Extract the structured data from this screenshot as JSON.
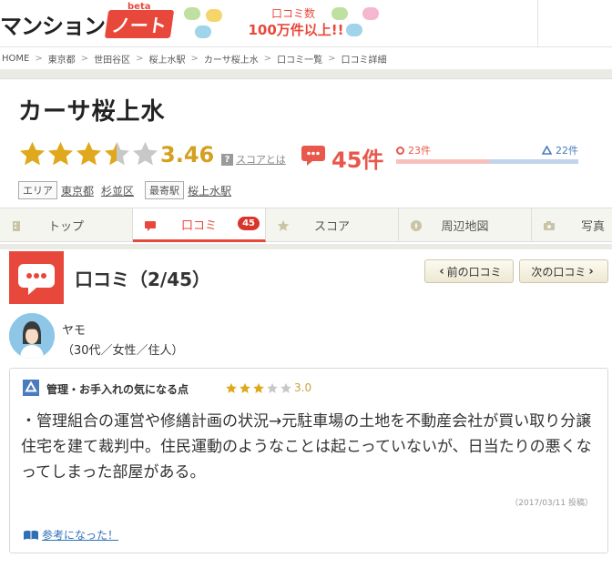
{
  "header": {
    "logo_main": "マンション",
    "logo_note": "ノート",
    "logo_beta": "beta",
    "promo_line1": "口コミ数",
    "promo_line2": "100万件以上!!"
  },
  "breadcrumb": [
    "HOME",
    "東京都",
    "世田谷区",
    "桜上水駅",
    "カーサ桜上水",
    "口コミ一覧",
    "口コミ詳細"
  ],
  "property": {
    "title": "カーサ桜上水",
    "score": "3.46",
    "score_rating": 3.46,
    "score_help": "スコアとは",
    "review_count": "45件",
    "good_count": "23件",
    "bad_count": "22件",
    "good_ratio": 0.51,
    "area_label": "エリア",
    "area_pref": "東京都",
    "area_ward": "杉並区",
    "station_label": "最寄駅",
    "station": "桜上水駅"
  },
  "tabs": [
    {
      "label": "トップ",
      "icon": "building-icon"
    },
    {
      "label": "口コミ",
      "icon": "speech-bubble-icon",
      "badge": "45"
    },
    {
      "label": "スコア",
      "icon": "star-icon"
    },
    {
      "label": "周辺地図",
      "icon": "compass-icon"
    },
    {
      "label": "写真",
      "icon": "camera-icon"
    }
  ],
  "review_header": {
    "title": "口コミ（2/45）",
    "prev_label": "前の口コミ",
    "next_label": "次の口コミ"
  },
  "reviewer": {
    "name": "ヤモ",
    "info": "（30代／女性／住人）"
  },
  "review": {
    "category": "管理・お手入れの気になる点",
    "rating": 3,
    "rating_label": "3.0",
    "body": "・管理組合の運営や修繕計画の状況→元駐車場の土地を不動産会社が買い取り分譲住宅を建て裁判中。住民運動のようなことは起こっていないが、日当たりの悪くなってしまった部屋がある。",
    "date": "（2017/03/11 投稿）",
    "helpful_label": "参考になった！"
  },
  "colors": {
    "brand_red": "#e8483b",
    "star_gold": "#e0a81c",
    "bad_blue": "#4b7bbf"
  }
}
